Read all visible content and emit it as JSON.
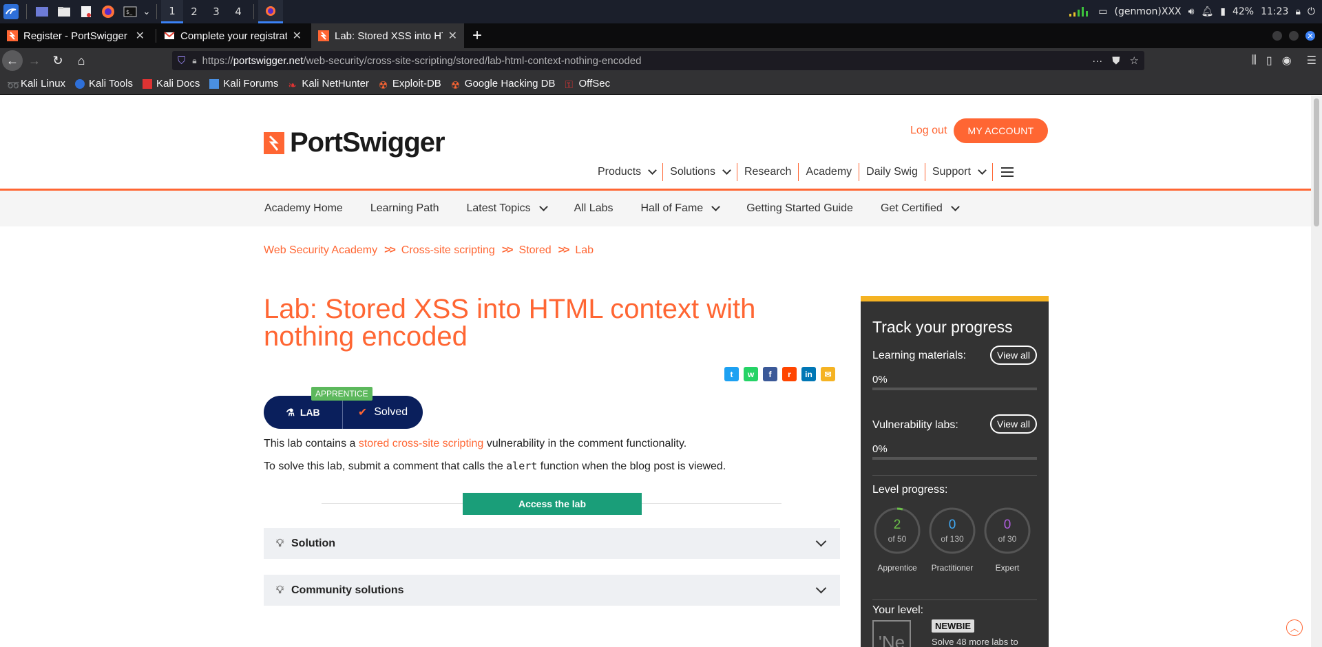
{
  "taskbar": {
    "workspaces": [
      "1",
      "2",
      "3",
      "4"
    ],
    "active_workspace": "1",
    "genmon": "(genmon)XXX",
    "battery": "42%",
    "clock": "11:23"
  },
  "browser": {
    "tabs": [
      {
        "title": "Register - PortSwigger",
        "icon": "portswigger-icon",
        "active": false
      },
      {
        "title": "Complete your registratio",
        "icon": "gmail-icon",
        "active": false
      },
      {
        "title": "Lab: Stored XSS into HTM",
        "icon": "portswigger-icon",
        "active": true
      }
    ],
    "url_scheme": "https://",
    "url_host": "portswigger.net",
    "url_path": "/web-security/cross-site-scripting/stored/lab-html-context-nothing-encoded",
    "bookmarks": [
      "Kali Linux",
      "Kali Tools",
      "Kali Docs",
      "Kali Forums",
      "Kali NetHunter",
      "Exploit-DB",
      "Google Hacking DB",
      "OffSec"
    ]
  },
  "site": {
    "logo_text": "PortSwigger",
    "logout": "Log out",
    "my_account": "MY ACCOUNT",
    "main_nav": [
      {
        "label": "Products",
        "dropdown": true
      },
      {
        "label": "Solutions",
        "dropdown": true
      },
      {
        "label": "Research",
        "dropdown": false
      },
      {
        "label": "Academy",
        "dropdown": false
      },
      {
        "label": "Daily Swig",
        "dropdown": false
      },
      {
        "label": "Support",
        "dropdown": true
      }
    ],
    "sub_nav": [
      {
        "label": "Academy Home",
        "dropdown": false
      },
      {
        "label": "Learning Path",
        "dropdown": false
      },
      {
        "label": "Latest Topics",
        "dropdown": true
      },
      {
        "label": "All Labs",
        "dropdown": false
      },
      {
        "label": "Hall of Fame",
        "dropdown": true
      },
      {
        "label": "Getting Started Guide",
        "dropdown": false
      },
      {
        "label": "Get Certified",
        "dropdown": true
      }
    ],
    "breadcrumb": [
      "Web Security Academy",
      "Cross-site scripting",
      "Stored",
      "Lab"
    ],
    "breadcrumb_sep": ">>"
  },
  "lab": {
    "title": "Lab: Stored XSS into HTML context with nothing encoded",
    "level_badge": "APPRENTICE",
    "lab_label": "LAB",
    "status": "Solved",
    "desc1_pre": "This lab contains a ",
    "desc1_link": "stored cross-site scripting",
    "desc1_post": " vulnerability in the comment functionality.",
    "desc2_pre": "To solve this lab, submit a comment that calls the ",
    "desc2_code": "alert",
    "desc2_post": " function when the blog post is viewed.",
    "access_button": "Access the lab",
    "accordions": [
      "Solution",
      "Community solutions"
    ],
    "share_icons": [
      {
        "name": "twitter-icon",
        "color": "#1da1f2",
        "glyph": "t"
      },
      {
        "name": "whatsapp-icon",
        "color": "#25d366",
        "glyph": "w"
      },
      {
        "name": "facebook-icon",
        "color": "#3b5998",
        "glyph": "f"
      },
      {
        "name": "reddit-icon",
        "color": "#ff4500",
        "glyph": "r"
      },
      {
        "name": "linkedin-icon",
        "color": "#0077b5",
        "glyph": "in"
      },
      {
        "name": "email-icon",
        "color": "#f5b323",
        "glyph": "✉"
      }
    ]
  },
  "progress": {
    "title": "Track your progress",
    "learning_label": "Learning materials:",
    "learning_pct": "0%",
    "vuln_label": "Vulnerability labs:",
    "vuln_pct": "0%",
    "view_all": "View all",
    "level_label": "Level progress:",
    "levels": [
      {
        "value": "2",
        "of": "of 50",
        "name": "Apprentice",
        "color": "#6cc04a",
        "fraction": 0.04
      },
      {
        "value": "0",
        "of": "of 130",
        "name": "Practitioner",
        "color": "#3fa9f5",
        "fraction": 0
      },
      {
        "value": "0",
        "of": "of 30",
        "name": "Expert",
        "color": "#b05ee0",
        "fraction": 0
      }
    ],
    "your_level_label": "Your level:",
    "level_box": "'Ne",
    "level_name": "NEWBIE",
    "solve_more": "Solve 48 more labs to"
  },
  "colors": {
    "brand_orange": "#ff6633",
    "lab_navy": "#0a1f5c",
    "access_green": "#1a9e79",
    "progress_gold": "#f5b323"
  }
}
